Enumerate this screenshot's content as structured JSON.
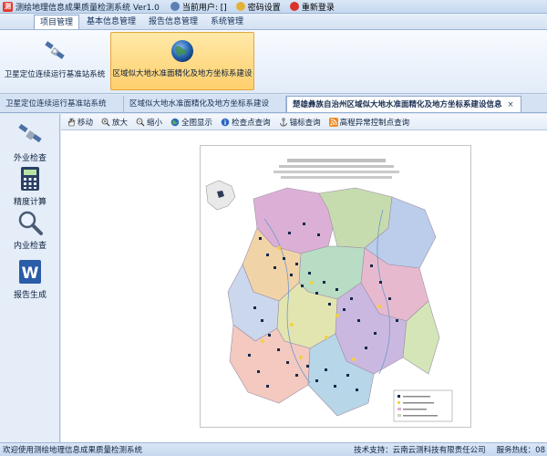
{
  "titlebar": {
    "title": "测绘地理信息成果质量检测系统 Ver1.0",
    "user_label": "当前用户: []",
    "password_label": "密码设置",
    "relogin_label": "重新登录"
  },
  "menu": {
    "tabs": [
      "项目管理",
      "基本信息管理",
      "报告信息管理",
      "系统管理"
    ]
  },
  "ribbon": {
    "btn1": "卫星定位连续运行基准站系统",
    "btn2": "区域似大地水准面精化及地方坐标系建设"
  },
  "doctabs": {
    "tab1": "卫星定位连续运行基准站系统",
    "tab2": "区域似大地水准面精化及地方坐标系建设",
    "tab3": "楚雄彝族自治州区域似大地水准面精化及地方坐标系建设信息",
    "close": "×"
  },
  "leftpanel": {
    "items": [
      "外业检查",
      "精度计算",
      "内业检查",
      "报告生成"
    ]
  },
  "maptools": {
    "items": [
      "移动",
      "放大",
      "缩小",
      "全图显示",
      "检查点查询",
      "锚标查询",
      "高程异常控制点查询"
    ]
  },
  "map": {
    "legend_title": "楚雄彝族自治州区域似大地水准面精化及地方坐标系建设"
  },
  "statusbar": {
    "welcome": "欢迎使用测绘地理信息成果质量检测系统",
    "support": "技术支持：云南云测科技有限责任公司",
    "hotline": "服务热线：08"
  },
  "colors": {
    "accent": "#ffcf6d",
    "chrome": "#dfe9f5"
  }
}
